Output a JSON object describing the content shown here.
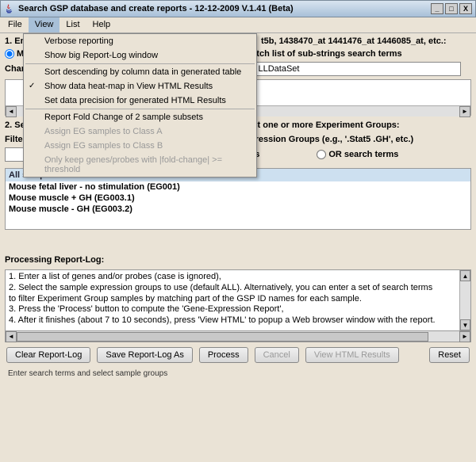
{
  "title": "Search GSP database and create reports - 12-12-2009 V.1.41 (Beta)",
  "menubar": {
    "file": "File",
    "view": "View",
    "list": "List",
    "help": "Help"
  },
  "viewmenu": {
    "i0": "Verbose reporting",
    "i1": "Show big Report-Log window",
    "i2": "Sort descending by column data in generated table",
    "i3": "Show data heat-map in View HTML Results",
    "i4": "Set data precision for generated HTML Results",
    "i5": "Report Fold Change of 2 sample subsets",
    "i6": "Assign EG samples to Class A",
    "i7": "Assign EG samples to Class B",
    "i8": "Only keep genes/probes with |fold-change| >= threshold"
  },
  "step1_prefix": "1. Ent",
  "step1_suffix": "t5b, 1438470_at 1441476_at 1446085_at, etc.:",
  "radio1a_prefix": "M",
  "radio1b": "atch list of sub-strings search terms",
  "changes_label_prefix": "Chan",
  "input1_value": "LLDataSet",
  "step2": "2. Select one or more Sample Experiment Groups. E.g., select one or more Experiment Groups:",
  "filter_label": "Filter further by optional AND/OR search sub-strings for Expression Groups (e.g., '.Stat5 .GH', etc.)",
  "radio_and": "AND search terms",
  "radio_or": "OR search terms",
  "samples_header": "All samples",
  "samples": {
    "s0": "Mouse fetal liver - no stimulation (EG001)",
    "s1": "Mouse muscle + GH (EG003.1)",
    "s2": "Mouse muscle - GH (EG003.2)"
  },
  "processing_label": "Processing Report-Log:",
  "log": {
    "l0": "1. Enter a list of genes and/or probes (case is ignored),",
    "l1": "2. Select the sample expression groups to use (default ALL). Alternatively, you can enter a set of search terms",
    "l1b": "    to filter Experiment Group samples by matching part of the GSP ID names for each sample.",
    "l2": "3. Press the 'Process' button to compute the 'Gene-Expression Report',",
    "l3": "4. After it finishes (about 7 to 10 seconds), press 'View HTML' to popup a Web browser window with the report."
  },
  "buttons": {
    "clear": "Clear Report-Log",
    "save": "Save Report-Log As",
    "process": "Process",
    "cancel": "Cancel",
    "view": "View HTML Results",
    "reset": "Reset"
  },
  "status": "Enter search terms and select sample groups"
}
